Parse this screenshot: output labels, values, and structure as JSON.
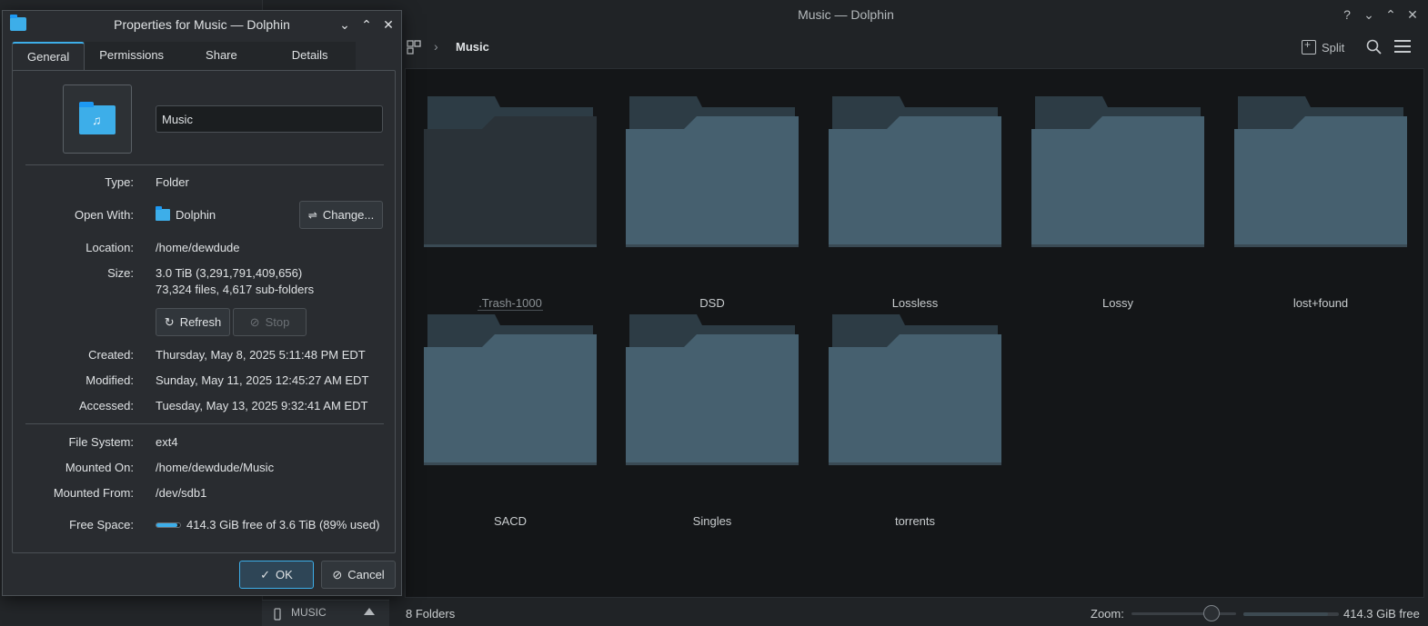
{
  "dolphin": {
    "title": "Music — Dolphin",
    "breadcrumb": "Music",
    "split_label": "Split",
    "folders": [
      ".Trash-1000",
      "DSD",
      "Lossless",
      "Lossy",
      "lost+found",
      "SACD",
      "Singles",
      "torrents"
    ],
    "status_count": "8 Folders",
    "zoom_label": "Zoom:",
    "free_space": "414.3 GiB free",
    "free_fraction": 0.89
  },
  "places": {
    "device_label": "MUSIC"
  },
  "dialog": {
    "title": "Properties for Music — Dolphin",
    "tabs": [
      "General",
      "Permissions",
      "Share",
      "Details"
    ],
    "name_value": "Music",
    "type_label": "Type:",
    "type_value": "Folder",
    "open_with_label": "Open With:",
    "open_with_value": "Dolphin",
    "change_label": "Change...",
    "location_label": "Location:",
    "location_value": "/home/dewdude",
    "size_label": "Size:",
    "size_value": "3.0 TiB (3,291,791,409,656)",
    "size_detail": "73,324 files, 4,617 sub-folders",
    "refresh_label": "Refresh",
    "stop_label": "Stop",
    "created_label": "Created:",
    "created_value": "Thursday, May 8, 2025 5:11:48 PM EDT",
    "modified_label": "Modified:",
    "modified_value": "Sunday, May 11, 2025 12:45:27 AM EDT",
    "accessed_label": "Accessed:",
    "accessed_value": "Tuesday, May 13, 2025 9:32:41 AM EDT",
    "fs_label": "File System:",
    "fs_value": "ext4",
    "mounted_on_label": "Mounted On:",
    "mounted_on_value": "/home/dewdude/Music",
    "mounted_from_label": "Mounted From:",
    "mounted_from_value": "/dev/sdb1",
    "free_label": "Free Space:",
    "free_value": "414.3 GiB free of 3.6 TiB (89% used)",
    "used_fraction": 0.89,
    "ok_label": "OK",
    "cancel_label": "Cancel"
  },
  "colors": {
    "accent": "#3daee9",
    "folder_body": "#46606f",
    "folder_tab": "#2d3c45",
    "trash_body": "#2a3238"
  }
}
